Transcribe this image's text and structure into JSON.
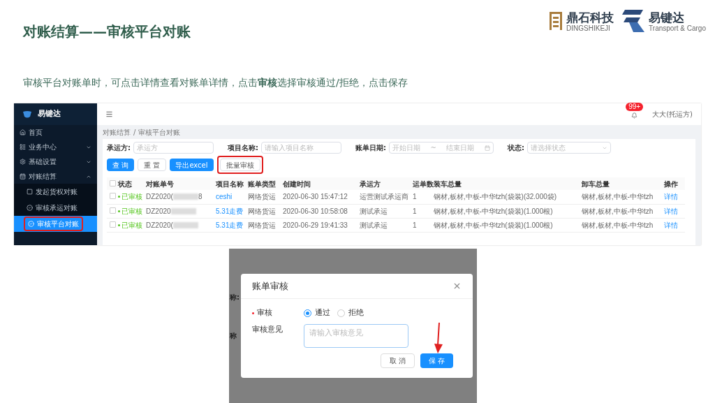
{
  "slide": {
    "title": "对账结算——审核平台对账",
    "subtitle": "审核平台对账单时，可点击详情查看对账单详情，点击**审核**选择审核通过/拒绝，点击保存"
  },
  "logos": [
    {
      "kind": "dingshi",
      "name": "鼎石科技",
      "tagline": "DINGSHIKEJI"
    },
    {
      "kind": "yijianda",
      "name": "易键达",
      "tagline": "Transport & Cargo"
    }
  ],
  "app": {
    "brand": "易键达",
    "sidebar": [
      {
        "label": "首页",
        "selected": false
      },
      {
        "label": "业务中心",
        "selected": false,
        "expanded": false
      },
      {
        "label": "基础设置",
        "selected": false,
        "expanded": false
      },
      {
        "label": "对账结算",
        "selected": false,
        "expanded": true,
        "children": [
          {
            "label": "发起货权对账",
            "selected": false,
            "highlighted": false
          },
          {
            "label": "审核承运对账",
            "selected": false,
            "highlighted": false
          },
          {
            "label": "审核平台对账",
            "selected": true,
            "highlighted": true
          }
        ]
      }
    ],
    "notification_badge": "99+",
    "user": "大大(托运方)",
    "breadcrumb": [
      "对账结算",
      "审核平台对账"
    ],
    "breadcrumb_separator": "/",
    "filters": [
      {
        "kind": "text",
        "label": "承运方:",
        "placeholder": "承运方"
      },
      {
        "kind": "text",
        "label": "项目名称:",
        "placeholder": "请输入项目名称"
      },
      {
        "kind": "daterange",
        "label": "账单日期:",
        "start": "开始日期",
        "separator": "~",
        "end": "结束日期"
      },
      {
        "kind": "select",
        "label": "状态:",
        "placeholder": "请选择状态"
      }
    ],
    "buttons": [
      {
        "label": "查 询",
        "kind": "primary",
        "highlighted": false
      },
      {
        "label": "重 置",
        "kind": "default",
        "highlighted": false
      },
      {
        "label": "导出excel",
        "kind": "primary",
        "highlighted": false
      },
      {
        "label": "批量审核",
        "kind": "default",
        "highlighted": true
      }
    ],
    "table": {
      "header_checked": false,
      "columns": [
        "状态",
        "对账单号",
        "项目名称",
        "账单类型",
        "创建时间",
        "承运方",
        "运单数",
        "装车总量",
        "卸车总量",
        "操作"
      ],
      "rows": [
        {
          "checked": false,
          "status": "已审核",
          "number": "DZ2020(",
          "number_tail": "8",
          "project": "ceshi",
          "type": "网络货运",
          "created": "2020-06-30 15:47:12",
          "carrier": "运营测试承运商",
          "count": "1",
          "loading": "钢材,板材,中板-中华tzh(袋装)(32.000袋)",
          "unloading": "钢材,板材,中板-中华tzh",
          "action": "详情"
        },
        {
          "checked": false,
          "status": "已审核",
          "number": "DZ2020",
          "number_tail": "",
          "project": "5.31走费",
          "type": "网络货运",
          "created": "2020-06-30 10:58:08",
          "carrier": "测试承运",
          "count": "1",
          "loading": "钢材,板材,中板-中华tzh(袋装)(1.000根)",
          "unloading": "钢材,板材,中板-中华tzh",
          "action": "详情"
        },
        {
          "checked": false,
          "status": "已审核",
          "number": "DZ2020(",
          "number_tail": "",
          "project": "5.31走费",
          "type": "网络货运",
          "created": "2020-06-29 19:41:33",
          "carrier": "测试承运",
          "count": "1",
          "loading": "钢材,板材,中板-中华tzh(袋装)(1.000根)",
          "unloading": "钢材,板材,中板-中华tzh",
          "action": "详情"
        }
      ]
    }
  },
  "dialog": {
    "background_labels": [
      "称:",
      "称"
    ],
    "title": "账单审核",
    "review_label": "审核",
    "required": true,
    "options": [
      {
        "label": "通过",
        "selected": true
      },
      {
        "label": "拒绝",
        "selected": false
      }
    ],
    "comment_label": "审核意见",
    "comment_placeholder": "请输入审核意见",
    "buttons": [
      {
        "label": "取 消",
        "kind": "default"
      },
      {
        "label": "保 存",
        "kind": "primary"
      }
    ]
  }
}
